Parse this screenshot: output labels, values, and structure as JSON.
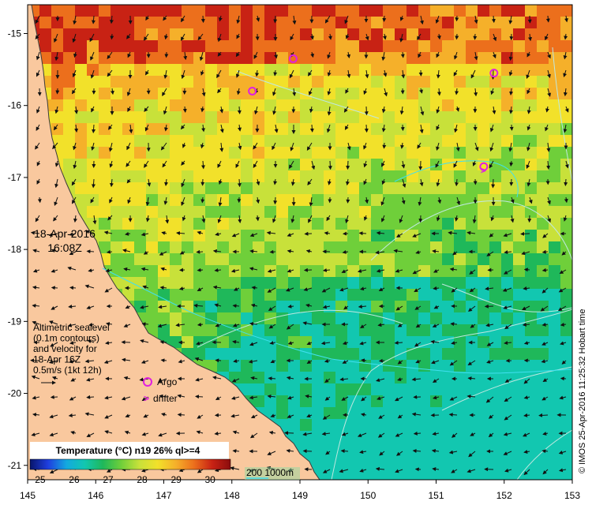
{
  "colors": {
    "land": "#f9c89e",
    "argo": "#e020e0",
    "drifter": "#e020e0",
    "contour": "#bfe8e0",
    "isobath": "#40e0f0",
    "arrow": "#111111"
  },
  "axes": {
    "lon_ticks": [
      "145",
      "146",
      "147",
      "148",
      "149",
      "150",
      "151",
      "152",
      "153"
    ],
    "lat_ticks": [
      "-15",
      "-16",
      "-17",
      "-18",
      "-19",
      "-20",
      "-21"
    ]
  },
  "annotation": {
    "date": "18-Apr-2016",
    "time": "16:08Z",
    "alt_lines": [
      "Altimetric sealevel",
      "(0.1m contours)",
      "and velocity for",
      "18-Apr 16Z",
      "0.5m/s (1kt 12h)"
    ]
  },
  "legend": {
    "argo_label": "Argo",
    "drifter_label": "drifter",
    "isobath_label": "200  1000m"
  },
  "colorbar": {
    "title": "Temperature (°C) n19 26% ql>=4",
    "ticks": [
      "25",
      "26",
      "27",
      "28",
      "29",
      "30"
    ],
    "stops": [
      "#08156b",
      "#1f3fe0",
      "#13a9e0",
      "#12c7b0",
      "#1fb85a",
      "#6fcf3a",
      "#c8e13a",
      "#f2e12a",
      "#f5b02a",
      "#ec6f1c",
      "#c82214",
      "#8a0d0d"
    ]
  },
  "side_text": "© IMOS 25-Apr-2016 11:25:32 Hobart time",
  "chart_data": {
    "type": "heatmap",
    "title": "Temperature (°C) n19 26% ql>=4",
    "xlabel": "",
    "ylabel": "",
    "xlim": [
      145,
      153
    ],
    "ylim": [
      -21.2,
      -14.6
    ],
    "colorbar_range": [
      24.7,
      30.6
    ],
    "argo_floats": [
      {
        "lon": 148.9,
        "lat": -15.35
      },
      {
        "lon": 148.3,
        "lat": -15.8
      },
      {
        "lon": 151.85,
        "lat": -15.55
      },
      {
        "lon": 151.7,
        "lat": -16.85
      }
    ],
    "drifters": [
      {
        "lon": 151.7,
        "lat": -16.9
      }
    ]
  }
}
